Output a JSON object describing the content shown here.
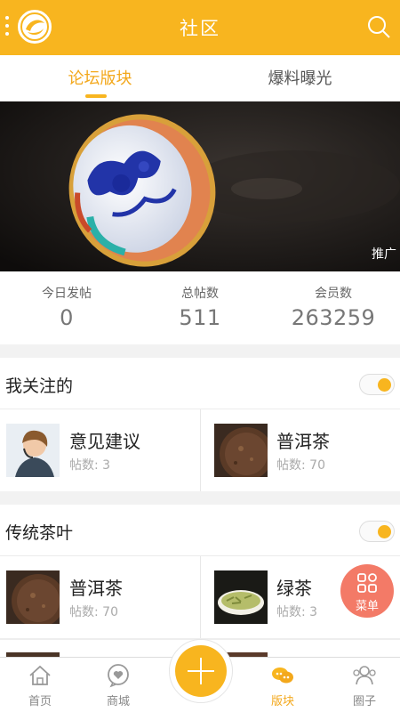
{
  "header": {
    "title": "社区"
  },
  "tabs": [
    {
      "label": "论坛版块",
      "active": true
    },
    {
      "label": "爆料曝光",
      "active": false
    }
  ],
  "banner": {
    "tag": "推广"
  },
  "stats": [
    {
      "label": "今日发帖",
      "value": "0"
    },
    {
      "label": "总帖数",
      "value": "511"
    },
    {
      "label": "会员数",
      "value": "263259"
    }
  ],
  "sections": [
    {
      "title": "我关注的",
      "items": [
        {
          "name": "意见建议",
          "count": "帖数: 3"
        },
        {
          "name": "普洱茶",
          "count": "帖数: 70"
        }
      ]
    },
    {
      "title": "传统茶叶",
      "items": [
        {
          "name": "普洱茶",
          "count": "帖数: 70"
        },
        {
          "name": "绿茶",
          "count": "帖数: 3"
        }
      ]
    }
  ],
  "fab": {
    "label": "菜单"
  },
  "bottom_nav": [
    {
      "label": "首页",
      "icon": "home-icon"
    },
    {
      "label": "商城",
      "icon": "heart-bubble-icon"
    },
    {
      "label": "版块",
      "icon": "chat-bubbles-icon",
      "active": true
    },
    {
      "label": "圈子",
      "icon": "people-icon"
    }
  ],
  "colors": {
    "accent": "#f8b51f",
    "fab": "#f37a67",
    "active_text": "#f3a81c"
  }
}
